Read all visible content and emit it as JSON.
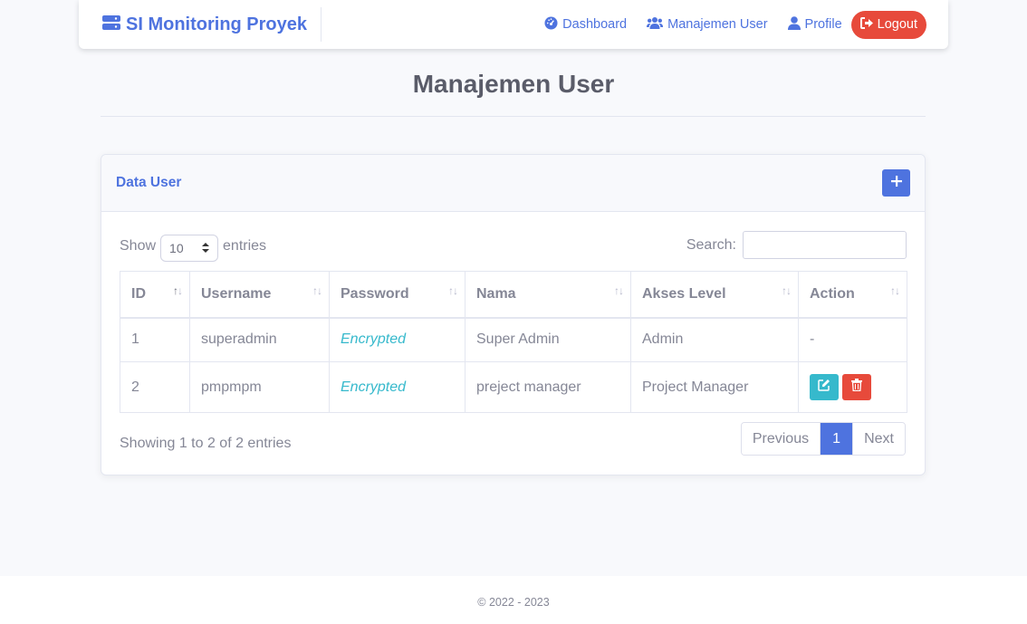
{
  "navbar": {
    "brand": "SI Monitoring Proyek",
    "brand_icon": "server-icon",
    "links": [
      {
        "label": "Dashboard",
        "icon": "tachometer-icon"
      },
      {
        "label": "Manajemen User",
        "icon": "users-icon"
      },
      {
        "label": "Profile",
        "icon": "user-icon"
      }
    ],
    "logout_label": "Logout"
  },
  "page": {
    "title": "Manajemen User"
  },
  "card": {
    "title": "Data User",
    "show_label": "Show",
    "entries_value": "10",
    "entries_label": "entries",
    "search_label": "Search:",
    "search_value": ""
  },
  "table": {
    "columns": [
      "ID",
      "Username",
      "Password",
      "Nama",
      "Akses Level",
      "Action"
    ],
    "rows": [
      {
        "id": "1",
        "username": "superadmin",
        "password": "Encrypted",
        "nama": "Super Admin",
        "akses": "Admin",
        "action": "-"
      },
      {
        "id": "2",
        "username": "pmpmpm",
        "password": "Encrypted",
        "nama": "preject manager",
        "akses": "Project Manager",
        "action": ""
      }
    ]
  },
  "pagination": {
    "info": "Showing 1 to 2 of 2 entries",
    "previous": "Previous",
    "current": "1",
    "next": "Next"
  },
  "footer": {
    "text": "© 2022 - 2023"
  },
  "colors": {
    "primary": "#4e73df",
    "danger": "#e74a3b",
    "info": "#36b9cc"
  }
}
